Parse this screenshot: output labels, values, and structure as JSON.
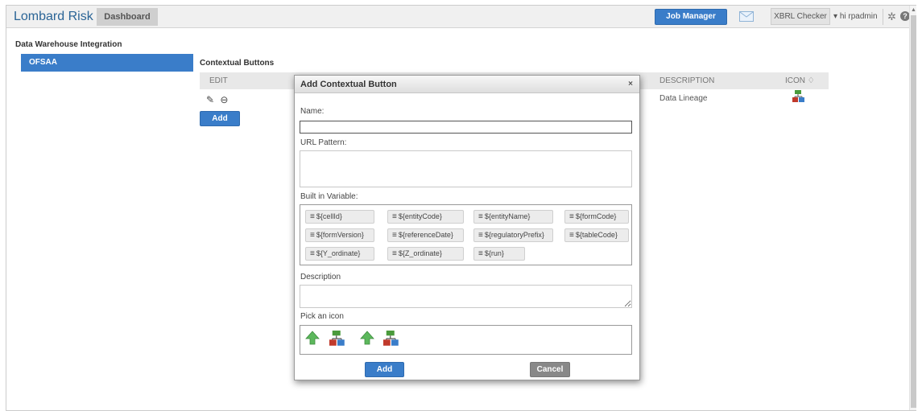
{
  "topbar": {
    "brand": "Lombard Risk",
    "dashboard_tab": "Dashboard",
    "job_manager": "Job Manager",
    "xbrl_checker": "XBRL Checker",
    "user": "hi rpadmin"
  },
  "sidebar": {
    "section_title": "Data Warehouse Integration",
    "items": [
      {
        "label": "OFSAA"
      }
    ]
  },
  "main": {
    "title": "Contextual Buttons",
    "columns": {
      "edit": "EDIT",
      "description": "DESCRIPTION",
      "icon": "ICON ♢"
    },
    "rows": [
      {
        "description": "Data Lineage"
      }
    ],
    "add_button": "Add"
  },
  "modal": {
    "title": "Add Contextual Button",
    "close": "×",
    "name_label": "Name:",
    "name_value": "",
    "url_label": "URL Pattern:",
    "url_value": "",
    "vars_label": "Built in Variable:",
    "variables": [
      "${cellId}",
      "${entityCode}",
      "${entityName}",
      "${formCode}",
      "${formVersion}",
      "${referenceDate}",
      "${regulatoryPrefix}",
      "${tableCode}",
      "${Y_ordinate}",
      "${Z_ordinate}",
      "${run}"
    ],
    "description_label": "Description",
    "description_value": "",
    "icon_label": "Pick an icon",
    "icons": [
      "green-up-arrow-icon",
      "data-lineage-icon",
      "green-up-arrow-icon",
      "data-lineage-icon"
    ],
    "add_button": "Add",
    "cancel_button": "Cancel"
  },
  "colors": {
    "accent": "#3a7dc9",
    "cancel": "#888888"
  }
}
